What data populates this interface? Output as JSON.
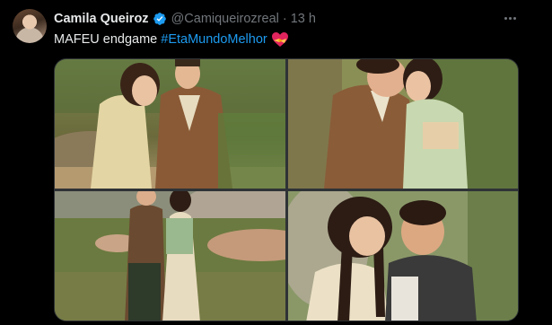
{
  "tweet": {
    "author_name": "Camila Queiroz",
    "author_handle": "@Camiqueirozreal",
    "separator": "·",
    "time": "13 h",
    "text": "MAFEU endgame",
    "hashtag": "#EtaMundoMelhor",
    "emoji_icon": "heart-with-ribbon-icon"
  },
  "colors": {
    "background": "#000000",
    "text": "#e7e9ea",
    "muted": "#71767b",
    "link": "#1d9bf0",
    "verified": "#1d9bf0"
  },
  "media": {
    "photos": [
      {
        "name": "couple-by-river-photo"
      },
      {
        "name": "couple-kissing-photo"
      },
      {
        "name": "couple-on-lake-shore-photo"
      },
      {
        "name": "couple-forehead-touch-photo"
      }
    ]
  }
}
